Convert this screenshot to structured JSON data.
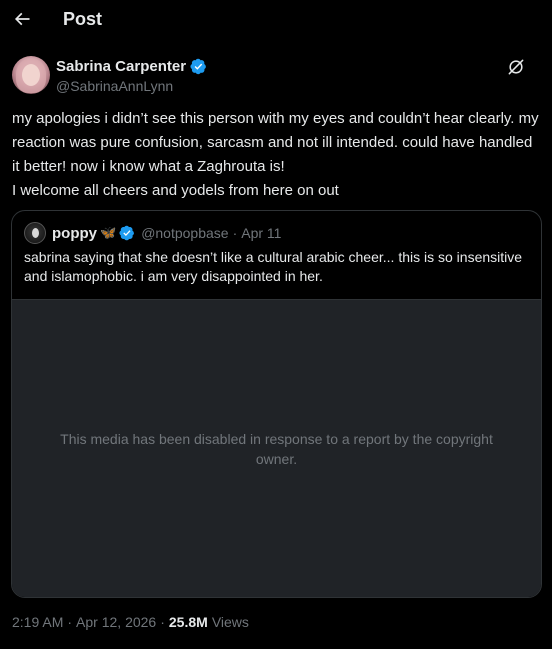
{
  "header": {
    "title": "Post"
  },
  "author": {
    "display_name": "Sabrina Carpenter",
    "handle": "@SabrinaAnnLynn",
    "verified": true
  },
  "post": {
    "text": "my apologies i didn’t see this person with my eyes and couldn’t hear clearly. my reaction was pure confusion, sarcasm and not ill intended. could have handled it better! now i know what a Zaghrouta is!\nI welcome all cheers and yodels from here on out"
  },
  "quote": {
    "display_name": "poppy",
    "emoji": "🦋",
    "handle": "@notpopbase",
    "separator": "·",
    "date": "Apr 11",
    "text": "sabrina saying that she doesn’t like a cultural arabic cheer... this is so insensitive and islamophobic. i am very disappointed in her.",
    "media_message": "This media has been disabled in response to a report by the copyright owner."
  },
  "footer": {
    "time": "2:19 AM",
    "separator1": "·",
    "date": "Apr 12, 2026",
    "separator2": "·",
    "views_count": "25.8M",
    "views_label": "Views"
  },
  "colors": {
    "background": "#000000",
    "text_primary": "#e7e9ea",
    "text_secondary": "#71767b",
    "verified_blue": "#1d9bf0",
    "border": "#2f3336",
    "media_bg": "#202327"
  },
  "icons": {
    "back": "arrow-left-icon",
    "verified": "verified-badge-icon",
    "grok": "grok-icon"
  }
}
